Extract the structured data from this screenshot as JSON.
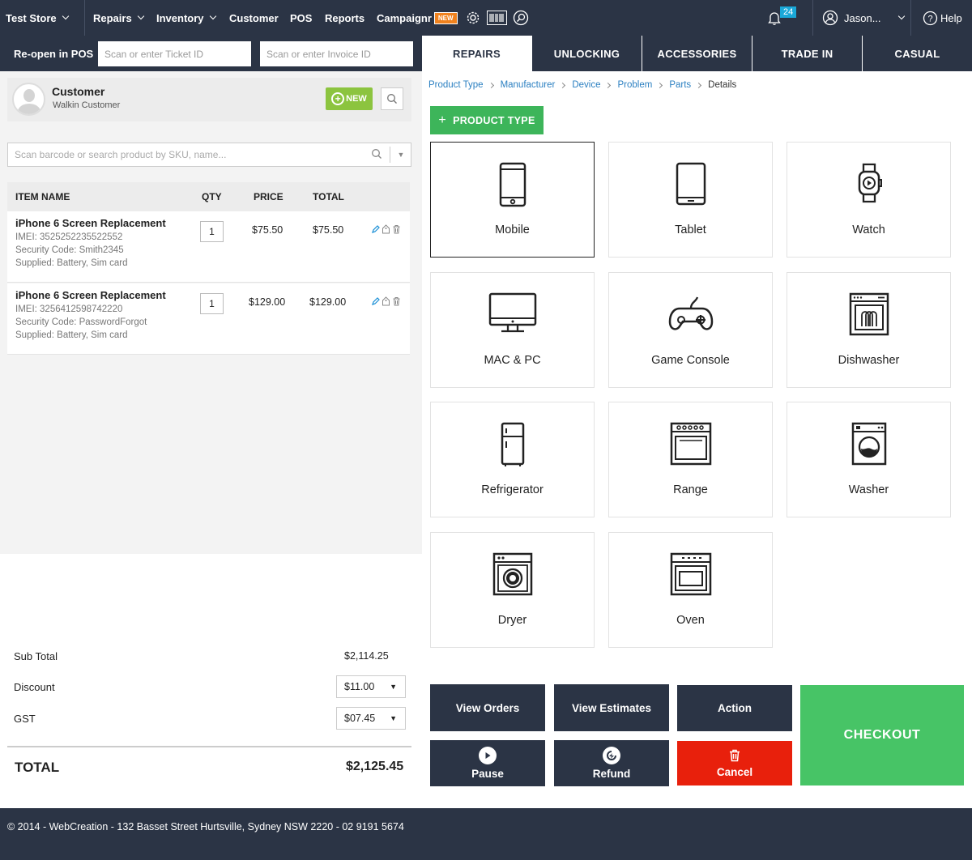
{
  "topbar": {
    "store": "Test Store",
    "nav": [
      "Repairs",
      "Inventory",
      "Customer",
      "POS",
      "Reports",
      "Campaignr"
    ],
    "new_badge": "NEW",
    "notif_count": "24",
    "user": "Jason...",
    "help": "Help"
  },
  "reopen": {
    "label": "Re-open in POS",
    "ticket_placeholder": "Scan or enter Ticket ID",
    "invoice_placeholder": "Scan or enter Invoice ID"
  },
  "tabs": [
    "REPAIRS",
    "UNLOCKING",
    "ACCESSORIES",
    "TRADE IN",
    "CASUAL"
  ],
  "customer": {
    "title": "Customer",
    "name": "Walkin Customer",
    "new_label": "NEW"
  },
  "search": {
    "placeholder": "Scan barcode or search product by SKU, name..."
  },
  "table": {
    "headers": [
      "ITEM NAME",
      "QTY",
      "PRICE",
      "TOTAL"
    ],
    "rows": [
      {
        "name": "iPhone 6 Screen Replacement",
        "imei": "IMEI: 3525252235522552",
        "security": "Security Code: Smith2345",
        "supplied": "Supplied: Battery, Sim card",
        "qty": "1",
        "price": "$75.50",
        "total": "$75.50"
      },
      {
        "name": "iPhone 6 Screen Replacement",
        "imei": "IMEI: 3256412598742220",
        "security": "Security Code: PasswordForgot",
        "supplied": "Supplied: Battery, Sim card",
        "qty": "1",
        "price": "$129.00",
        "total": "$129.00"
      }
    ]
  },
  "totals": {
    "subtotal_label": "Sub Total",
    "subtotal": "$2,114.25",
    "discount_label": "Discount",
    "discount": "$11.00",
    "gst_label": "GST",
    "gst": "$07.45",
    "total_label": "TOTAL",
    "total": "$2,125.45"
  },
  "breadcrumb": [
    "Product Type",
    "Manufacturer",
    "Device",
    "Problem",
    "Parts",
    "Details"
  ],
  "product_type_button": "PRODUCT TYPE",
  "tiles": [
    {
      "label": "Mobile",
      "icon": "mobile-icon"
    },
    {
      "label": "Tablet",
      "icon": "tablet-icon"
    },
    {
      "label": "Watch",
      "icon": "watch-icon"
    },
    {
      "label": "MAC & PC",
      "icon": "monitor-icon"
    },
    {
      "label": "Game Console",
      "icon": "gamepad-icon"
    },
    {
      "label": "Dishwasher",
      "icon": "dishwasher-icon"
    },
    {
      "label": "Refrigerator",
      "icon": "refrigerator-icon"
    },
    {
      "label": "Range",
      "icon": "range-icon"
    },
    {
      "label": "Washer",
      "icon": "washer-icon"
    },
    {
      "label": "Dryer",
      "icon": "dryer-icon"
    },
    {
      "label": "Oven",
      "icon": "oven-icon"
    }
  ],
  "actions": {
    "view_orders": "View Orders",
    "view_estimates": "View Estimates",
    "action": "Action",
    "pause": "Pause",
    "refund": "Refund",
    "cancel": "Cancel",
    "checkout": "CHECKOUT"
  },
  "colors": {
    "navy": "#2b3445",
    "green": "#47c466",
    "red": "#e8200c",
    "link": "#2a7fc1"
  },
  "footer": "© 2014 - WebCreation - 132 Basset Street Hurtsville, Sydney NSW 2220 - 02 9191 5674"
}
